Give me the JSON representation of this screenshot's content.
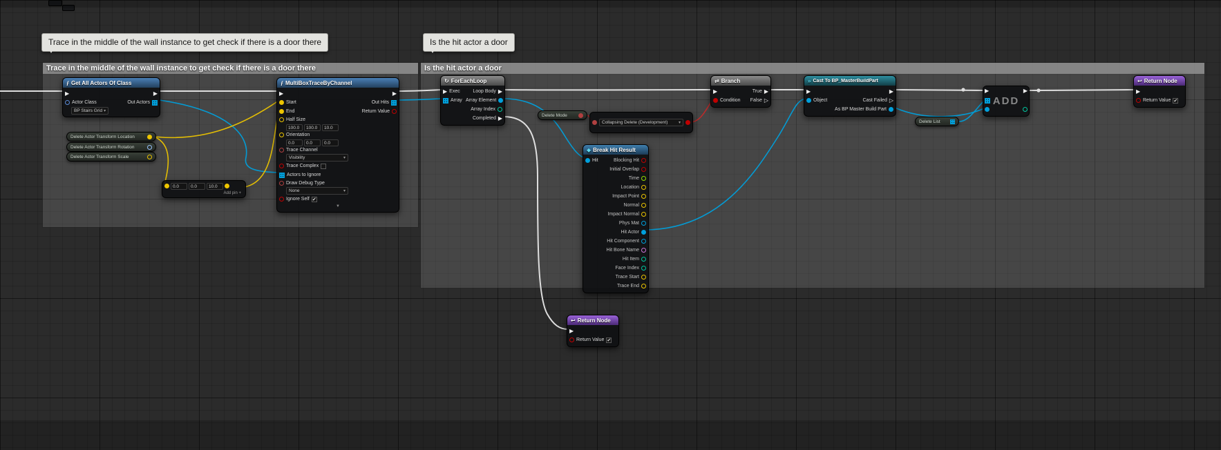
{
  "icons": {
    "function": "ƒ",
    "loop": "↻",
    "branch": "⇄",
    "cast": "»",
    "struct": "◆",
    "return": "↩",
    "dropdown_arrow": "▾",
    "collapse_arrow": "▼",
    "check": "✔",
    "exec_filled": "▶",
    "exec_hollow": "▷"
  },
  "colors": {
    "exec_wire": "#e8e8e8",
    "vector": "#edc500",
    "object": "#00a0dc",
    "bool": "#c00000",
    "float": "#97e000",
    "int": "#00c9a0",
    "name": "#cf72d8",
    "enum": "#b04040",
    "function_header": "#4a7fb5",
    "cast_header": "#2e8fa0",
    "return_header": "#9a63d8",
    "comment_header": "#949494"
  },
  "comments": [
    {
      "bubble": "Trace in the middle of the wall instance to get check if there is a door there",
      "title": "Trace in the middle of the wall instance to get check if there is a door there"
    },
    {
      "bubble": "Is the hit actor a door",
      "title": "Is the hit actor a door"
    }
  ],
  "nodes": {
    "getAllActors": {
      "title": "Get All Actors Of Class",
      "actor_class_label": "Actor Class",
      "actor_class_value": "BP Stairs Grid",
      "out_actors_label": "Out Actors"
    },
    "multiBoxTrace": {
      "title": "MultiBoxTraceByChannel",
      "start": "Start",
      "end": "End",
      "half_size_label": "Half Size",
      "half_size": [
        "100.0",
        "100.0",
        "10.0"
      ],
      "orientation_label": "Orientation",
      "orientation": [
        "0.0",
        "0.0",
        "0.0"
      ],
      "trace_channel_label": "Trace Channel",
      "trace_channel_value": "Visibility",
      "trace_complex_label": "Trace Complex",
      "actors_to_ignore_label": "Actors to Ignore",
      "draw_debug_label": "Draw Debug Type",
      "draw_debug_value": "None",
      "ignore_self_label": "Ignore Self",
      "out_hits_label": "Out Hits",
      "return_value_label": "Return Value"
    },
    "varLocation": {
      "label": "Delete Actor Transform Location"
    },
    "varRotation": {
      "label": "Delete Actor Transform Rotation"
    },
    "varScale": {
      "label": "Delete Actor Transform Scale"
    },
    "addVector": {
      "fields": [
        "0.0",
        "0.0",
        "10.0"
      ],
      "add_pin": "Add pin +"
    },
    "forEachLoop": {
      "title": "ForEachLoop",
      "exec": "Exec",
      "array": "Array",
      "loop_body": "Loop Body",
      "array_element": "Array Element",
      "array_index": "Array Index",
      "completed": "Completed"
    },
    "deleteMode": {
      "label": "Delete Mode"
    },
    "equalEnum": {
      "value": "Collapsing Delete (Development)"
    },
    "breakHitResult": {
      "title": "Break Hit Result",
      "hit": "Hit",
      "outputs": [
        "Blocking Hit",
        "Initial Overlap",
        "Time",
        "Location",
        "Impact Point",
        "Normal",
        "Impact Normal",
        "Phys Mat",
        "Hit Actor",
        "Hit Component",
        "Hit Bone Name",
        "Hit Item",
        "Face Index",
        "Trace Start",
        "Trace End"
      ]
    },
    "branch": {
      "title": "Branch",
      "condition": "Condition",
      "true_label": "True",
      "false_label": "False"
    },
    "cast": {
      "title": "Cast To BP_MasterBuildPart",
      "object": "Object",
      "cast_failed": "Cast Failed",
      "as_part": "As BP Master Build Part"
    },
    "deleteList": {
      "label": "Delete List"
    },
    "addArray": {
      "watermark": "ADD"
    },
    "returnTop": {
      "title": "Return Node",
      "return_value": "Return Value"
    },
    "returnBottom": {
      "title": "Return Node",
      "return_value": "Return Value"
    }
  }
}
